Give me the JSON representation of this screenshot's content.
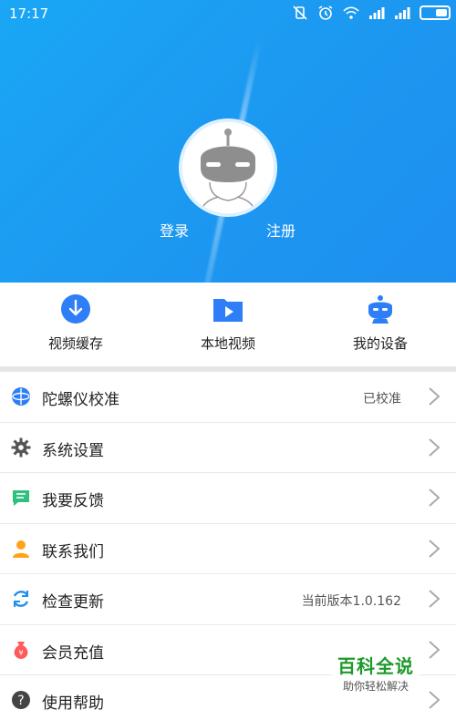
{
  "statusbar": {
    "time": "17:17"
  },
  "header": {
    "login_label": "登录",
    "register_label": "注册"
  },
  "quick_actions": [
    {
      "label": "视频缓存",
      "icon": "download-circle-icon"
    },
    {
      "label": "本地视频",
      "icon": "folder-play-icon"
    },
    {
      "label": "我的设备",
      "icon": "robot-device-icon"
    }
  ],
  "menu": [
    {
      "label": "陀螺仪校准",
      "value": "已校准",
      "icon": "gyroscope-icon",
      "color": "#2d7ef7"
    },
    {
      "label": "系统设置",
      "value": "",
      "icon": "gear-icon",
      "color": "#555555"
    },
    {
      "label": "我要反馈",
      "value": "",
      "icon": "feedback-icon",
      "color": "#2fc07f"
    },
    {
      "label": "联系我们",
      "value": "",
      "icon": "contact-person-icon",
      "color": "#ffa21a"
    },
    {
      "label": "检查更新",
      "value": "当前版本1.0.162",
      "icon": "refresh-icon",
      "color": "#1e8ff0"
    },
    {
      "label": "会员充值",
      "value": "",
      "icon": "money-bag-icon",
      "color": "#ff5a5a"
    },
    {
      "label": "使用帮助",
      "value": "",
      "icon": "help-icon",
      "color": "#444444"
    }
  ],
  "watermark": {
    "title": "百科全说",
    "subtitle": "助你轻松解决"
  },
  "colors": {
    "hero_blue": "#1c9af1",
    "accent_blue": "#2d7ef7"
  }
}
